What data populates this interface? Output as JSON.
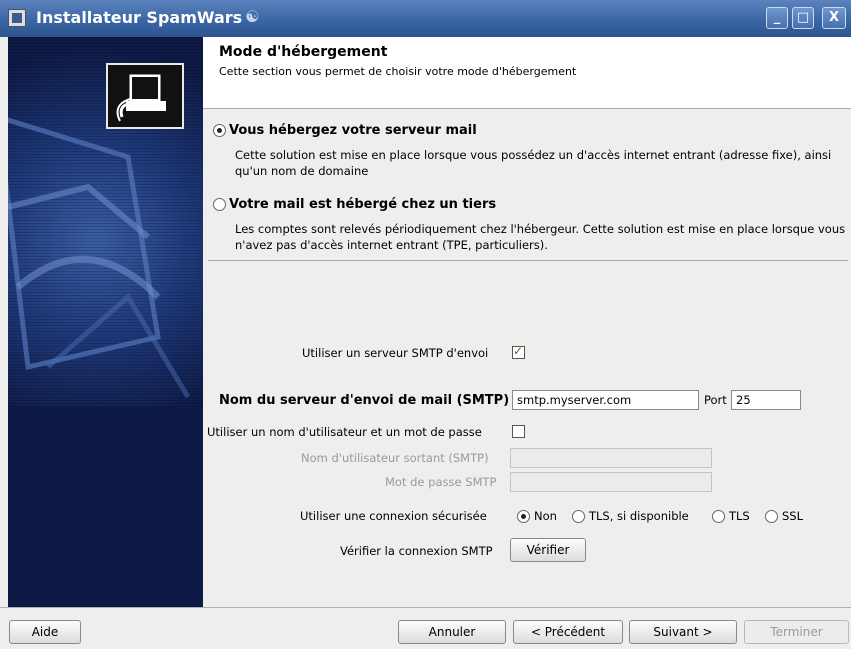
{
  "window": {
    "title": "Installateur SpamWars",
    "icon": "app-icon",
    "controls": {
      "minimize": "_",
      "maximize": "□",
      "close": "X"
    }
  },
  "header": {
    "title": "Mode d'hébergement",
    "subtitle": "Cette section vous permet de choisir votre mode d'hébergement"
  },
  "hosting": {
    "option1": {
      "label": "Vous hébergez votre serveur mail",
      "selected": true,
      "description": "Cette solution est mise en place lorsque vous possédez un d'accès internet entrant (adresse fixe), ainsi qu'un nom de domaine"
    },
    "option2": {
      "label": "Votre mail est hébergé chez un tiers",
      "selected": false,
      "description": "Les comptes sont relevés périodiquement chez l'hébergeur. Cette solution est mise en place lorsque vous n'avez pas d'accès internet entrant (TPE, particuliers)."
    }
  },
  "smtp": {
    "use_smtp_label": "Utiliser un serveur SMTP d'envoi",
    "use_smtp_checked": true,
    "server_label": "Nom du serveur d'envoi de mail (SMTP)",
    "server_value": "smtp.myserver.com",
    "port_label": "Port",
    "port_value": "25",
    "auth_label": "Utiliser un nom d'utilisateur et un mot de passe",
    "auth_checked": false,
    "username_label": "Nom d'utilisateur sortant (SMTP)",
    "username_value": "",
    "password_label": "Mot de passe SMTP",
    "password_value": "",
    "secure_label": "Utiliser une connexion sécurisée",
    "secure_options": [
      "Non",
      "TLS, si disponible",
      "TLS",
      "SSL"
    ],
    "secure_selected": "Non",
    "verify_label": "Vérifier la connexion SMTP",
    "verify_button": "Vérifier"
  },
  "footer": {
    "help": "Aide",
    "cancel": "Annuler",
    "previous": "< Précédent",
    "next": "Suivant >",
    "finish": "Terminer"
  }
}
